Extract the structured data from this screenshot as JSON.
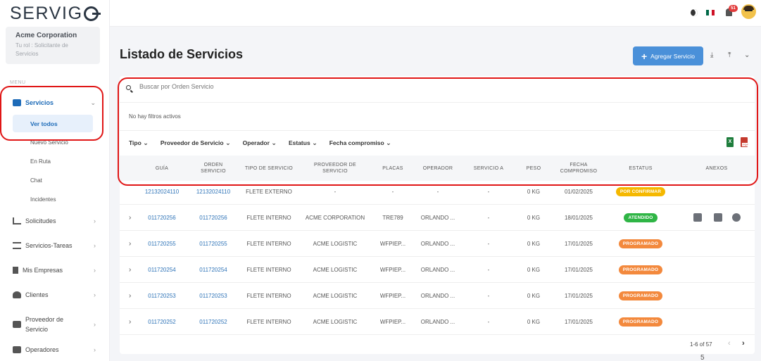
{
  "logo": "SERVIGO",
  "org": {
    "name": "Acme Corporation",
    "role": "Tu rol : Solicitante de Servicios"
  },
  "menu_label": "MENU",
  "nav": {
    "servicios": "Servicios",
    "ver_todos": "Ver todos",
    "nuevo_servicio": "Nuevo Servicio",
    "en_ruta": "En Ruta",
    "chat": "Chat",
    "incidentes": "Incidentes",
    "solicitudes": "Solicitudes",
    "servicios_tareas": "Servicios-Tareas",
    "mis_empresas": "Mis Empresas",
    "clientes": "Clientes",
    "proveedor": "Proveedor de Servicio",
    "operadores": "Operadores"
  },
  "topbar": {
    "notifications": "51"
  },
  "page_title": "Listado de Servicios",
  "add_button": "Agregar Servicio",
  "search": {
    "placeholder": "Buscar por Orden Servicio"
  },
  "filters_note": "No hay filtros activos",
  "filters": [
    "Tipo",
    "Proveedor de Servicio",
    "Operador",
    "Estatus",
    "Fecha compromiso"
  ],
  "columns": [
    "GUÍA",
    "ORDEN SERVICIO",
    "TIPO DE SERVICIO",
    "PROVEEDOR DE SERVICIO",
    "PLACAS",
    "OPERADOR",
    "SERVICIO A",
    "PESO",
    "FECHA COMPROMISO",
    "ESTATUS",
    "ANEXOS"
  ],
  "rows": [
    {
      "guia": "12132024110",
      "orden": "12132024110",
      "tipo": "FLETE EXTERNO",
      "proveedor": "-",
      "placas": "-",
      "operador": "-",
      "servicio_a": "-",
      "peso": "0 KG",
      "fecha": "01/02/2025",
      "estatus": "POR CONFIRMAR",
      "status_color": "#f5b800"
    },
    {
      "guia": "011720256",
      "orden": "011720256",
      "tipo": "FLETE INTERNO",
      "proveedor": "ACME CORPORATION",
      "placas": "TRE789",
      "operador": "ORLANDO ...",
      "servicio_a": "-",
      "peso": "0 KG",
      "fecha": "18/01/2025",
      "estatus": "ATENDIDO",
      "status_color": "#2fb545"
    },
    {
      "guia": "011720255",
      "orden": "011720255",
      "tipo": "FLETE INTERNO",
      "proveedor": "ACME LOGISTIC",
      "placas": "WFPIEP...",
      "operador": "ORLANDO ...",
      "servicio_a": "-",
      "peso": "0 KG",
      "fecha": "17/01/2025",
      "estatus": "PROGRAMADO",
      "status_color": "#f3893d"
    },
    {
      "guia": "011720254",
      "orden": "011720254",
      "tipo": "FLETE INTERNO",
      "proveedor": "ACME LOGISTIC",
      "placas": "WFPIEP...",
      "operador": "ORLANDO ...",
      "servicio_a": "-",
      "peso": "0 KG",
      "fecha": "17/01/2025",
      "estatus": "PROGRAMADO",
      "status_color": "#f3893d"
    },
    {
      "guia": "011720253",
      "orden": "011720253",
      "tipo": "FLETE INTERNO",
      "proveedor": "ACME LOGISTIC",
      "placas": "WFPIEP...",
      "operador": "ORLANDO ...",
      "servicio_a": "-",
      "peso": "0 KG",
      "fecha": "17/01/2025",
      "estatus": "PROGRAMADO",
      "status_color": "#f3893d"
    },
    {
      "guia": "011720252",
      "orden": "011720252",
      "tipo": "FLETE INTERNO",
      "proveedor": "ACME LOGISTIC",
      "placas": "WFPIEP...",
      "operador": "ORLANDO ...",
      "servicio_a": "-",
      "peso": "0 KG",
      "fecha": "17/01/2025",
      "estatus": "PROGRAMADO",
      "status_color": "#f3893d"
    }
  ],
  "pager": "1-6 of 57",
  "stray_text": "5"
}
